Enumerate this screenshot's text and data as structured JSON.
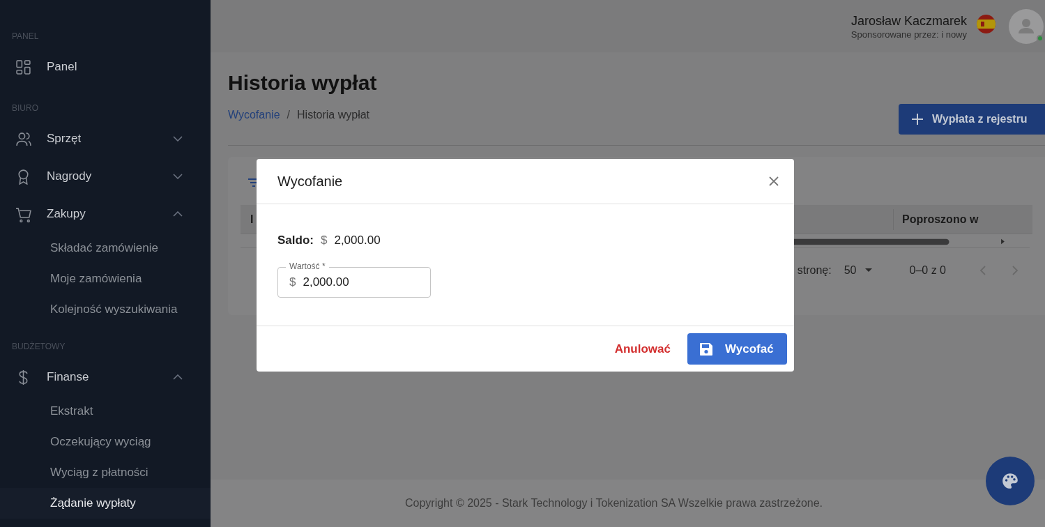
{
  "sidebar": {
    "sections": [
      {
        "label": "PANEL",
        "items": [
          {
            "label": "Panel"
          }
        ]
      },
      {
        "label": "BIURO",
        "items": [
          {
            "label": "Sprzęt",
            "expanded": false
          },
          {
            "label": "Nagrody",
            "expanded": false
          },
          {
            "label": "Zakupy",
            "expanded": true,
            "children": [
              {
                "label": "Składać zamówienie",
                "selected": false
              },
              {
                "label": "Moje zamówienia",
                "selected": false
              },
              {
                "label": "Kolejność wyszukiwania",
                "selected": false
              }
            ]
          }
        ]
      },
      {
        "label": "BUDŻETOWY",
        "items": [
          {
            "label": "Finanse",
            "expanded": true,
            "children": [
              {
                "label": "Ekstrakt",
                "selected": false
              },
              {
                "label": "Oczekujący wyciąg",
                "selected": false
              },
              {
                "label": "Wyciąg z płatności",
                "selected": false
              },
              {
                "label": "Żądanie wypłaty",
                "selected": true
              }
            ]
          }
        ]
      }
    ]
  },
  "header": {
    "user_name": "Jarosław Kaczmarek",
    "sponsor": "Sponsorowane przez: i nowy"
  },
  "page": {
    "title": "Historia wypłat",
    "breadcrumb": [
      {
        "label": "Wycofanie",
        "kind": "link"
      },
      {
        "label": "/",
        "kind": "separator"
      },
      {
        "label": "Historia wypłat",
        "kind": "current"
      }
    ],
    "action_button": "Wypłata z rejestru"
  },
  "table": {
    "columns": [
      {
        "label": "I"
      },
      {
        "label": "Poproszono w"
      }
    ],
    "pagination": {
      "rows_label": "stronę:",
      "per_page": "50",
      "range": "0–0 z 0"
    }
  },
  "footer": {
    "copyright": "Copyright © 2025 - Stark Technology i Tokenization SA Wszelkie prawa zastrzeżone."
  },
  "modal": {
    "title": "Wycofanie",
    "balance_label": "Saldo:",
    "balance_currency": "$",
    "balance": "2,000.00",
    "field": {
      "label": "Wartość *",
      "prefix": "$",
      "value": "2,000.00"
    },
    "cancel": "Anulować",
    "submit": "Wycofać"
  }
}
